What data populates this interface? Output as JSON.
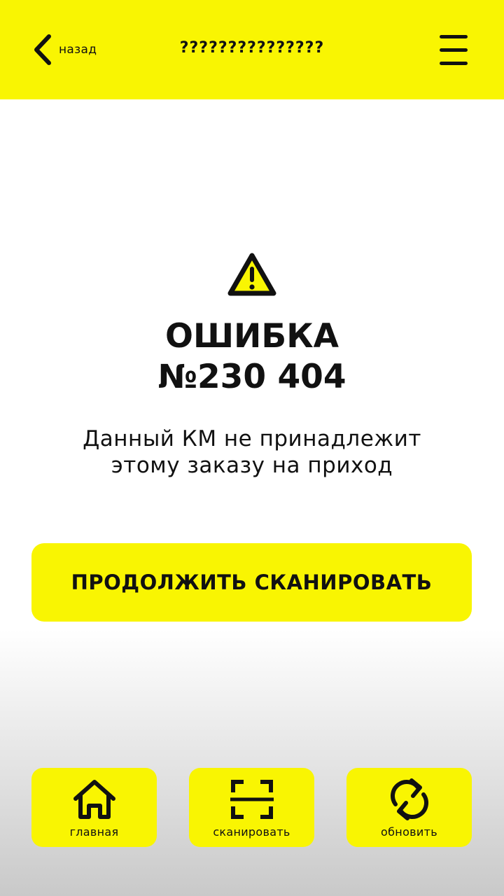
{
  "header": {
    "back_label": "назад",
    "title": "???????????????",
    "back_icon": "chevron-left-icon",
    "menu_icon": "hamburger-menu-icon"
  },
  "error": {
    "icon": "warning-triangle-icon",
    "title_line1": "ОШИБКА",
    "title_line2": "№230 404",
    "message_line1": "Данный КМ не принадлежит",
    "message_line2": "этому заказу на приход"
  },
  "actions": {
    "continue_label": "ПРОДОЛЖИТЬ СКАНИРОВАТЬ"
  },
  "tabbar": {
    "items": [
      {
        "label": "главная",
        "icon": "home-icon"
      },
      {
        "label": "сканировать",
        "icon": "scan-icon"
      },
      {
        "label": "обновить",
        "icon": "refresh-icon"
      }
    ]
  },
  "colors": {
    "accent": "#f9f502",
    "text": "#111111",
    "background": "#ffffff"
  }
}
